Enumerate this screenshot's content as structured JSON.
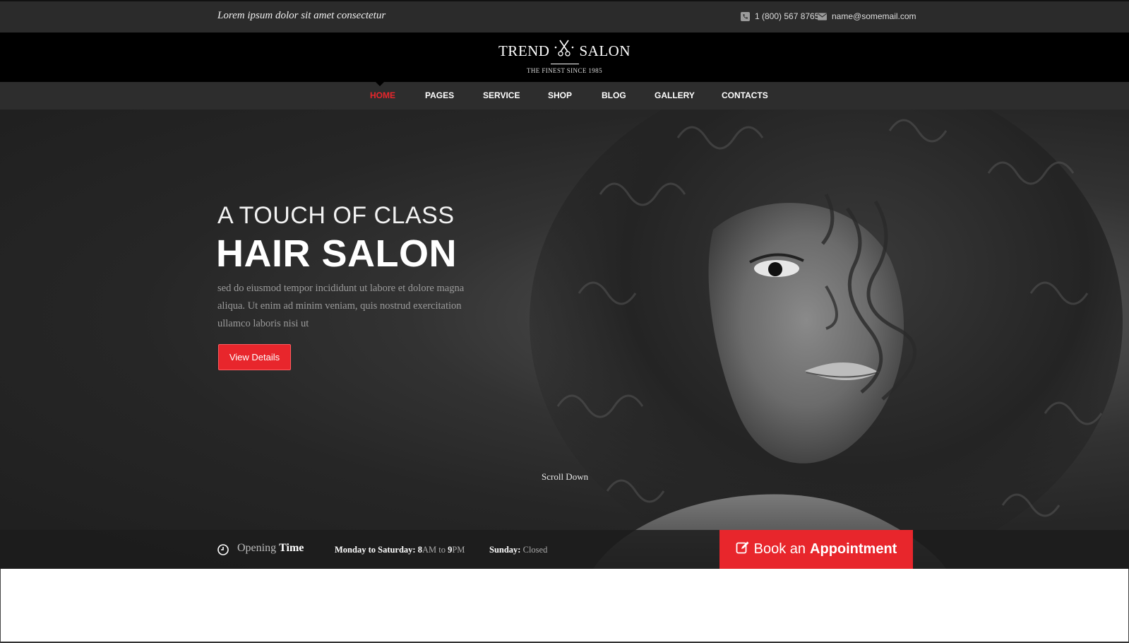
{
  "topbar": {
    "tagline": "Lorem ipsum dolor sit amet consectetur",
    "phone": "1 (800) 567 8765",
    "phone_icon": "phone-icon",
    "email": "name@somemail.com",
    "email_icon": "envelope-icon"
  },
  "logo": {
    "left": "TREND",
    "right": "SALON",
    "icon": "scissors-icon",
    "tagline": "THE FINEST SINCE 1985"
  },
  "nav": {
    "items": [
      {
        "label": "HOME",
        "active": true
      },
      {
        "label": "PAGES"
      },
      {
        "label": "SERVICE"
      },
      {
        "label": "SHOP"
      },
      {
        "label": "BLOG"
      },
      {
        "label": "GALLERY"
      },
      {
        "label": "CONTACTS"
      }
    ]
  },
  "hero": {
    "subtitle": "A TOUCH OF CLASS",
    "title": "HAIR SALON",
    "text": "sed do eiusmod tempor incididunt ut labore et dolore magna aliqua. Ut enim ad minim veniam, quis nostrud exercitation ullamco laboris nisi ut",
    "button": "View Details",
    "scroll": "Scroll Down"
  },
  "opening": {
    "icon": "clock-icon",
    "label_light": "Opening",
    "label_bold": "Time",
    "weekdays_label": "Monday to Saturday:",
    "weekdays_open_num": "8",
    "weekdays_open_unit": "AM",
    "weekdays_to": "to",
    "weekdays_close_num": "9",
    "weekdays_close_unit": "PM",
    "sunday_label": "Sunday:",
    "sunday_value": "Closed"
  },
  "booking": {
    "icon": "edit-icon",
    "text_light": "Book an",
    "text_bold": "Appointment"
  },
  "colors": {
    "accent": "#e8262c",
    "topbar": "#2b2b2b",
    "logobar": "#000000",
    "navbar": "#2d2d2d"
  }
}
